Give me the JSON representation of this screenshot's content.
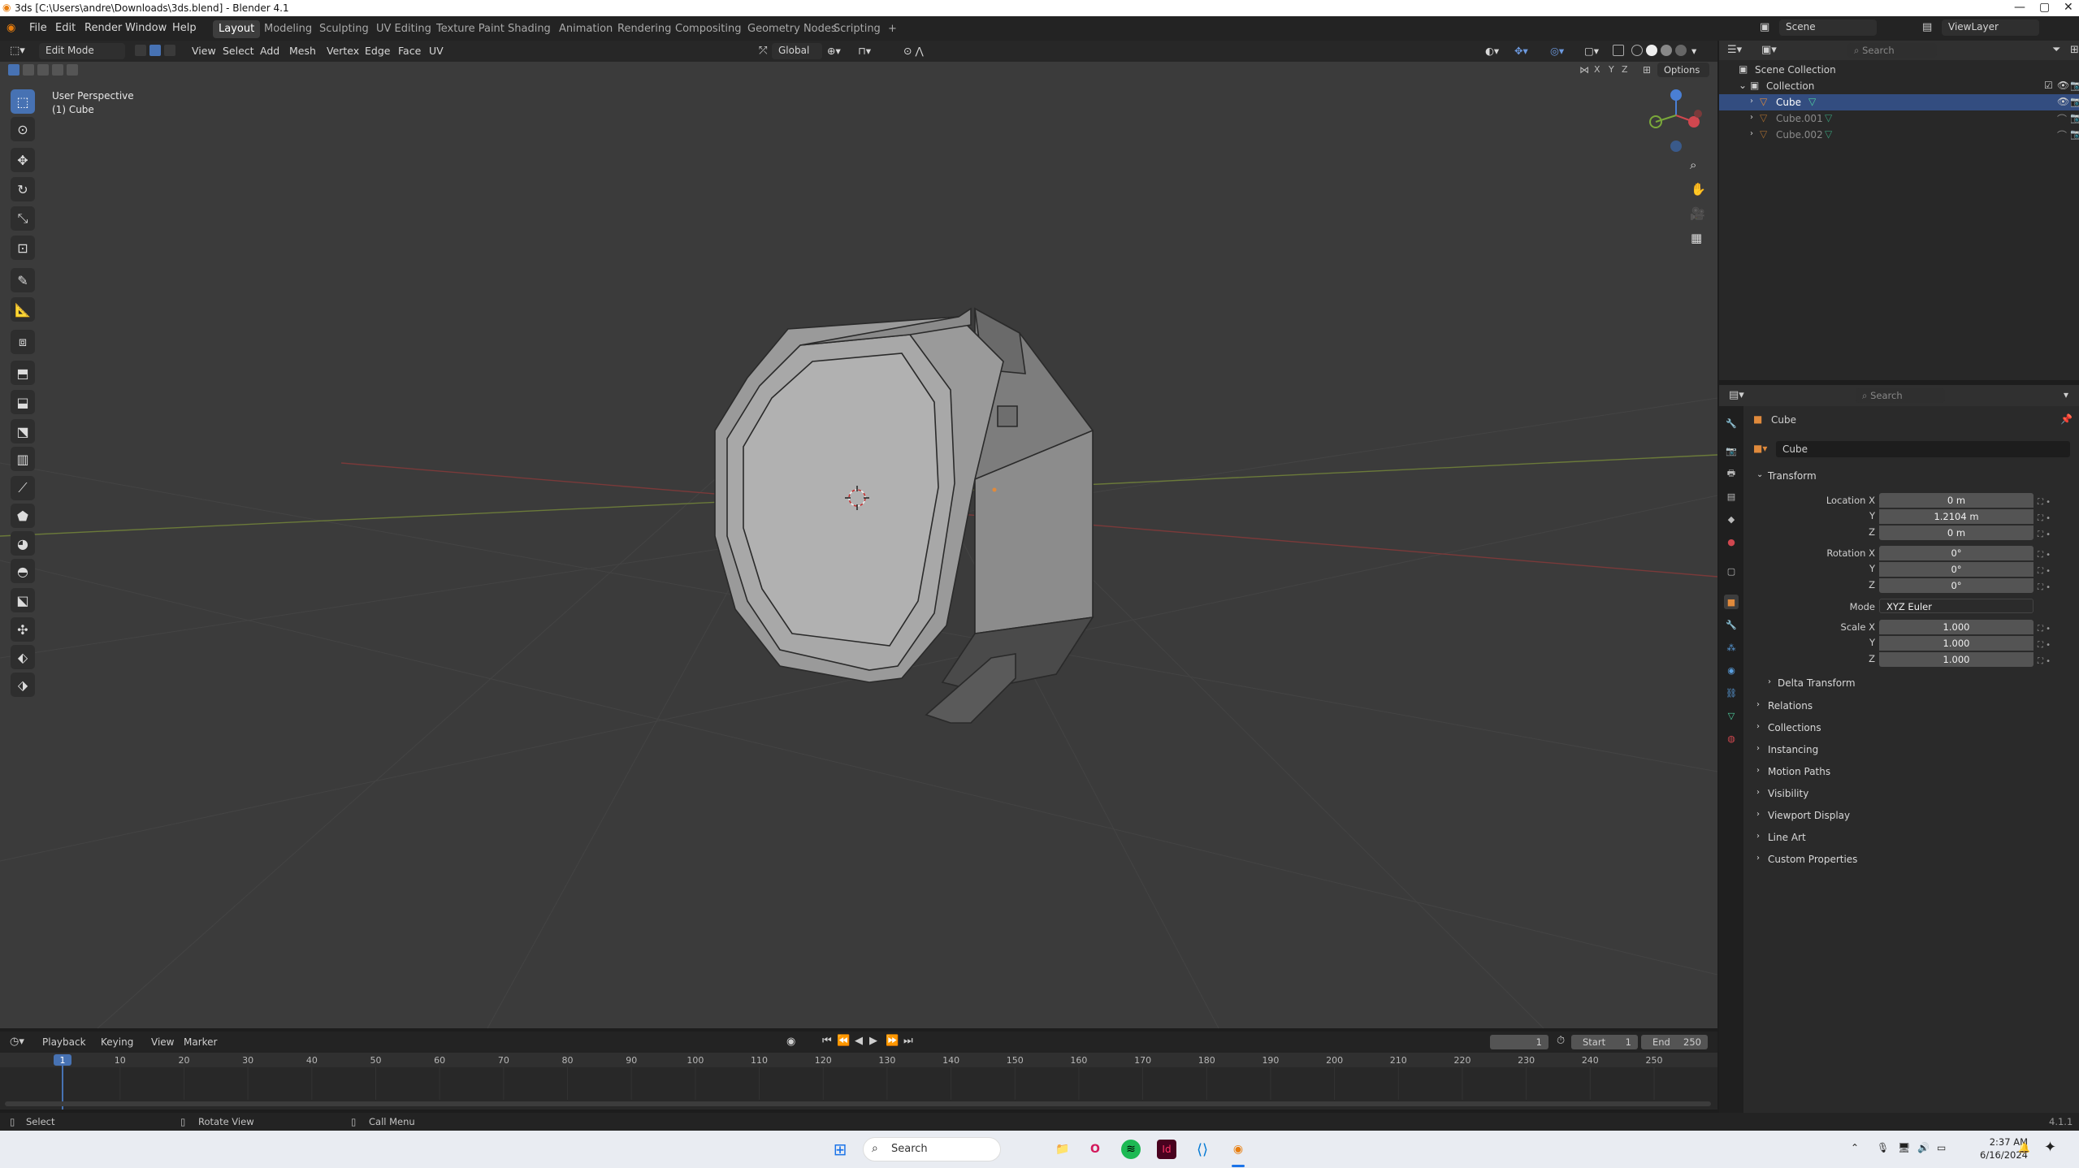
{
  "window": {
    "title": "3ds [C:\\Users\\andre\\Downloads\\3ds.blend] - Blender 4.1",
    "controls": [
      "—",
      "▢",
      "✕"
    ]
  },
  "menubar": [
    "File",
    "Edit",
    "Render",
    "Window",
    "Help"
  ],
  "workspaces": [
    "Layout",
    "Modeling",
    "Sculpting",
    "UV Editing",
    "Texture Paint",
    "Shading",
    "Animation",
    "Rendering",
    "Compositing",
    "Geometry Nodes",
    "Scripting"
  ],
  "active_workspace": "Layout",
  "scene": {
    "label": "Scene",
    "view_layer": "ViewLayer"
  },
  "viewport": {
    "mode": "Edit Mode",
    "menus": [
      "View",
      "Select",
      "Add",
      "Mesh",
      "Vertex",
      "Edge",
      "Face",
      "UV"
    ],
    "transform_orientation": "Global",
    "options_label": "Options",
    "axis_x": "X",
    "axis_y": "Y",
    "axis_z": "Z",
    "info_line1": "User Perspective",
    "info_line2": "(1) Cube",
    "search_placeholder": "Search"
  },
  "outliner": {
    "search_placeholder": "Search",
    "scene_collection": "Scene Collection",
    "collection": "Collection",
    "objects": [
      "Cube",
      "Cube.001",
      "Cube.002"
    ],
    "selected": "Cube"
  },
  "properties": {
    "search_placeholder": "Search",
    "object_name": "Cube",
    "data_name": "Cube",
    "transform_label": "Transform",
    "location_label": "Location X",
    "location": [
      "0 m",
      "1.2104 m",
      "0 m"
    ],
    "rotation_label": "Rotation X",
    "rotation": [
      "0°",
      "0°",
      "0°"
    ],
    "mode_label": "Mode",
    "mode_value": "XYZ Euler",
    "scale_label": "Scale X",
    "scale": [
      "1.000",
      "1.000",
      "1.000"
    ],
    "y_label": "Y",
    "z_label": "Z",
    "delta_transform": "Delta Transform",
    "panels": [
      "Relations",
      "Collections",
      "Instancing",
      "Motion Paths",
      "Visibility",
      "Viewport Display",
      "Line Art",
      "Custom Properties"
    ]
  },
  "timeline": {
    "menus": [
      "Playback",
      "Keying",
      "View",
      "Marker"
    ],
    "current_frame": "1",
    "start_label": "Start",
    "start": "1",
    "end_label": "End",
    "end": "250",
    "ticks": [
      "10",
      "20",
      "30",
      "40",
      "50",
      "60",
      "70",
      "80",
      "90",
      "100",
      "110",
      "120",
      "130",
      "140",
      "150",
      "160",
      "170",
      "180",
      "190",
      "200",
      "210",
      "220",
      "230",
      "240",
      "250"
    ]
  },
  "statusbar": {
    "select": "Select",
    "rotate": "Rotate View",
    "menu": "Call Menu",
    "version": "4.1.1"
  },
  "taskbar": {
    "search": "Search",
    "time": "2:37 AM",
    "date": "6/16/2024"
  },
  "colors": {
    "accent": "#4772b3",
    "selected_row": "#334d80",
    "viewport_bg": "#3b3b3b",
    "object_orange": "#e08a3c"
  }
}
